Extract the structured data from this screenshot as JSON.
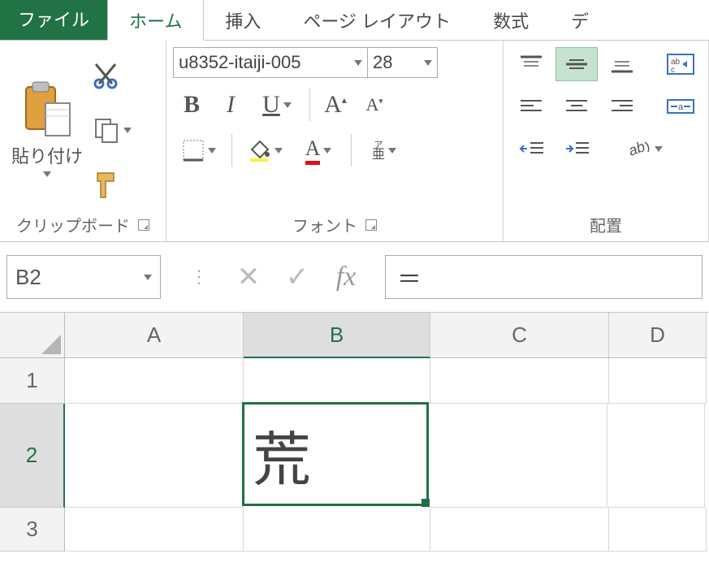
{
  "tabs": {
    "file": "ファイル",
    "home": "ホーム",
    "insert": "挿入",
    "layout": "ページ レイアウト",
    "formulas": "数式",
    "more": "デ"
  },
  "ribbon": {
    "clipboard": {
      "paste": "貼り付け",
      "label": "クリップボード"
    },
    "font": {
      "name": "u8352-itaiji-005",
      "size": "28",
      "bold": "B",
      "italic": "I",
      "underline": "U",
      "growA": "A",
      "shrinkA": "A",
      "fillA": "A",
      "phonetic": "ア\n亜",
      "label": "フォント"
    },
    "align": {
      "label": "配置"
    }
  },
  "formula": {
    "namebox": "B2",
    "value": "＝"
  },
  "grid": {
    "cols": [
      "A",
      "B",
      "C",
      "D"
    ],
    "rows": [
      "1",
      "2",
      "3"
    ],
    "b2": "荒"
  }
}
